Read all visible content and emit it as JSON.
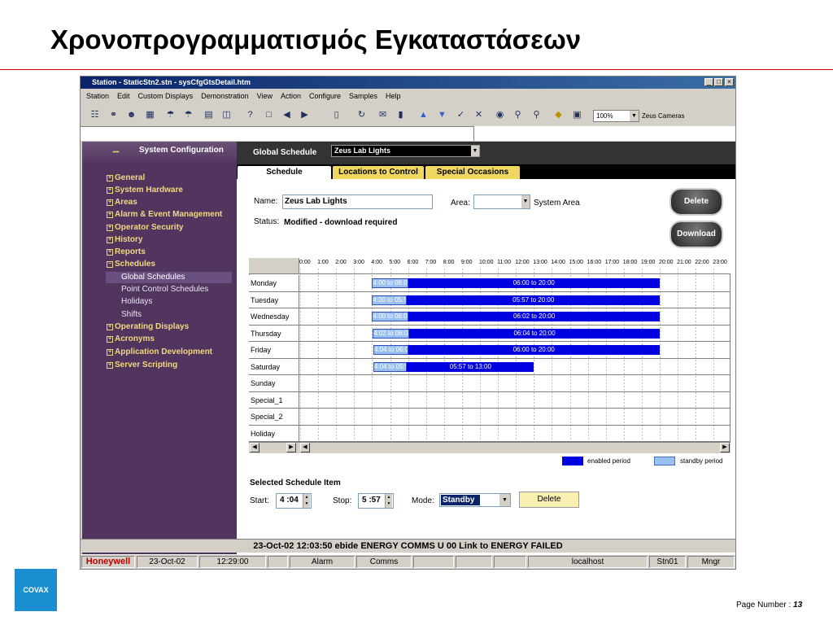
{
  "slide": {
    "title": "Χρονοπρογραμματισμός Εγκαταστάσεων",
    "page_label": "Page Number : ",
    "page_number": "13",
    "logo_text": "COVAX"
  },
  "window": {
    "title": "Station - StaticStn2.stn - sysCfgGtsDetail.htm",
    "controls": [
      "_",
      "□",
      "×"
    ],
    "menu": [
      "Station",
      "Edit",
      "Custom Displays",
      "Demonstration",
      "View",
      "Action",
      "Configure",
      "Samples",
      "Help"
    ],
    "zoom": "100%",
    "zeus_cameras": "Zeus Cameras"
  },
  "sidebar": {
    "header": "System Configuration",
    "items": [
      {
        "label": "General",
        "pm": "⊞"
      },
      {
        "label": "System Hardware",
        "pm": "⊞"
      },
      {
        "label": "Areas",
        "pm": "⊞"
      },
      {
        "label": "Alarm & Event Management",
        "pm": "⊞"
      },
      {
        "label": "Operator Security",
        "pm": "⊞"
      },
      {
        "label": "History",
        "pm": "⊞"
      },
      {
        "label": "Reports",
        "pm": "⊞"
      },
      {
        "label": "Schedules",
        "pm": "⊟"
      }
    ],
    "subitems": [
      "Global Schedules",
      "Point Control Schedules",
      "Holidays",
      "Shifts"
    ],
    "items2": [
      {
        "label": "Operating Displays",
        "pm": "⊞"
      },
      {
        "label": "Acronyms",
        "pm": "⊞"
      },
      {
        "label": "Application Development",
        "pm": "⊞"
      },
      {
        "label": "Server Scripting",
        "pm": "⊞"
      }
    ]
  },
  "global_schedule": {
    "label": "Global Schedule",
    "selected": "Zeus Lab Lights"
  },
  "tabs": [
    "Schedule",
    "Locations to Control",
    "Special Occasions"
  ],
  "form": {
    "name_label": "Name:",
    "name_value": "Zeus Lab Lights",
    "area_label": "Area:",
    "area_value": "System Area",
    "status_label": "Status:",
    "status_value": "Modified - download required",
    "delete_button": "Delete",
    "download_button": "Download"
  },
  "hours": [
    "0:00",
    "1:00",
    "2:00",
    "3:00",
    "4:00",
    "5:00",
    "6:00",
    "7:00",
    "8:00",
    "9:00",
    "10:00",
    "11:00",
    "12:00",
    "13:00",
    "14:00",
    "15:00",
    "16:00",
    "17:00",
    "18:00",
    "19:00",
    "20:00",
    "21:00",
    "22:00",
    "23:00"
  ],
  "days": [
    "Monday",
    "Tuesday",
    "Wednesday",
    "Thursday",
    "Friday",
    "Saturday",
    "Sunday",
    "Special_1",
    "Special_2",
    "Holiday"
  ],
  "periods": [
    {
      "row": 0,
      "standby": "4:00 to 06:00",
      "s_start": 4.0,
      "s_end": 6.0,
      "enabled": "06:00 to 20:00",
      "e_start": 6.0,
      "e_end": 20.0
    },
    {
      "row": 1,
      "standby": "4:00 to 05:57",
      "s_start": 4.0,
      "s_end": 5.95,
      "enabled": "05:57 to 20:00",
      "e_start": 5.95,
      "e_end": 20.0
    },
    {
      "row": 2,
      "standby": "4:00 to 06:02",
      "s_start": 4.0,
      "s_end": 6.03,
      "enabled": "06:02 to 20:00",
      "e_start": 6.03,
      "e_end": 20.0
    },
    {
      "row": 3,
      "standby": "4:02 to 06:04",
      "s_start": 4.03,
      "s_end": 6.07,
      "enabled": "06:04 to 20:00",
      "e_start": 6.07,
      "e_end": 20.0
    },
    {
      "row": 4,
      "standby": "4:04 to 06:00",
      "s_start": 4.07,
      "s_end": 6.0,
      "enabled": "06:00 to 20:00",
      "e_start": 6.0,
      "e_end": 20.0
    },
    {
      "row": 5,
      "standby": "4:04 to 05:57",
      "s_start": 4.07,
      "s_end": 5.95,
      "enabled": "05:57 to 13:00",
      "e_start": 5.95,
      "e_end": 13.0
    }
  ],
  "legend": {
    "enabled": "enabled period",
    "standby": "standby period",
    "enabled_color": "#0000e0",
    "standby_color": "#99c0f0"
  },
  "selected_item": {
    "heading": "Selected Schedule Item",
    "start_label": "Start:",
    "start_value": "4 :04",
    "stop_label": "Stop:",
    "stop_value": "5 :57",
    "mode_label": "Mode:",
    "mode_value": "Standby",
    "delete_button": "Delete"
  },
  "alarm_line": "23-Oct-02 12:03:50   ebide   ENERGY   COMMS   U 00   Link to ENERGY   FAILED",
  "status": {
    "brand": "Honeywell",
    "date": "23-Oct-02",
    "time": "12:29:00",
    "alarm": "Alarm",
    "comms": "Comms",
    "host": "localhost",
    "station": "Stn01",
    "user": "Mngr"
  }
}
